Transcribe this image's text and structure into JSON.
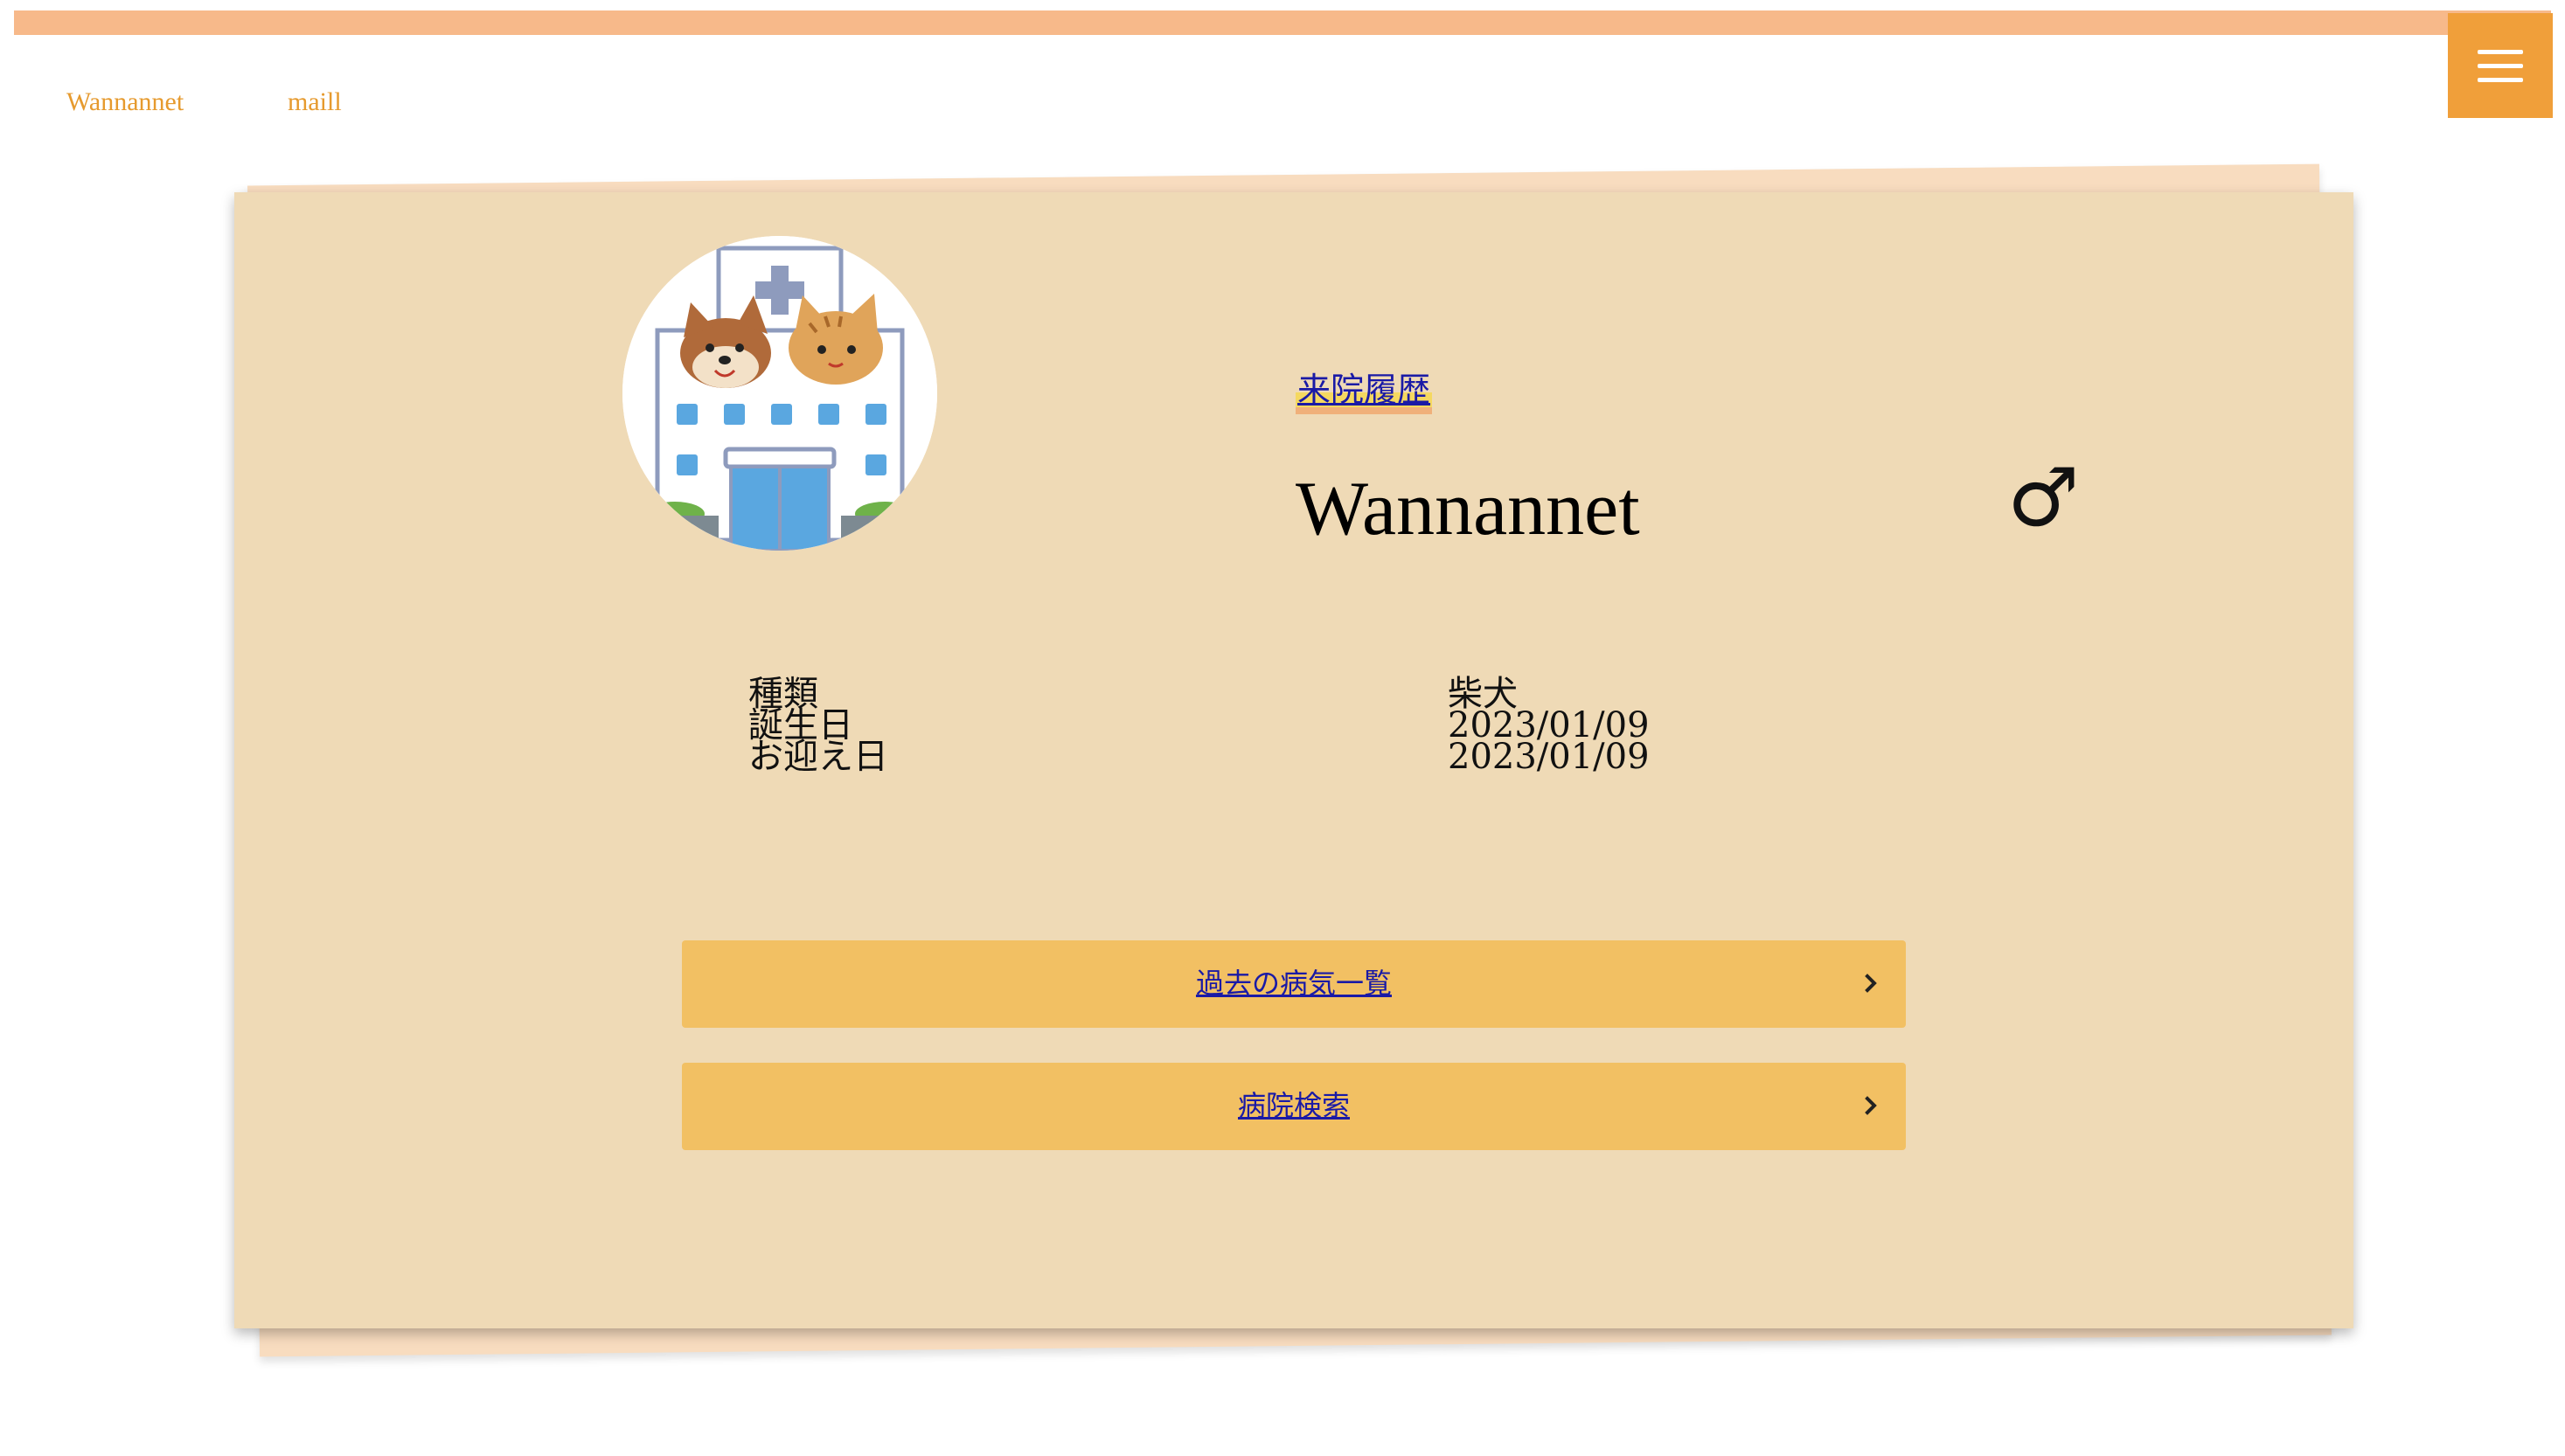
{
  "header": {
    "nav": [
      {
        "label": "Wannannet"
      },
      {
        "label": "maill"
      }
    ],
    "menu_icon": "hamburger-icon"
  },
  "profile": {
    "history_link": "来院履歴",
    "name": "Wannannet",
    "sex_symbol": "♂",
    "sex_icon": "male-icon",
    "avatar": "animal-hospital-illustration",
    "info": {
      "labels": [
        "種類",
        "誕生日",
        "お迎え日"
      ],
      "values": [
        "柴犬",
        "2023/01/09",
        "2023/01/09"
      ]
    }
  },
  "actions": [
    {
      "label": "過去の病気一覧",
      "icon": "chevron-right-icon"
    },
    {
      "label": "病院検索",
      "icon": "chevron-right-icon"
    }
  ],
  "colors": {
    "top_bar": "#f7b98a",
    "menu_button": "#f09f3a",
    "card": "#efdab6",
    "card_back": "#f8dcbf",
    "action_button": "#f2c063",
    "nav_text": "#e69a2e",
    "link_text": "#1a1aa6"
  }
}
